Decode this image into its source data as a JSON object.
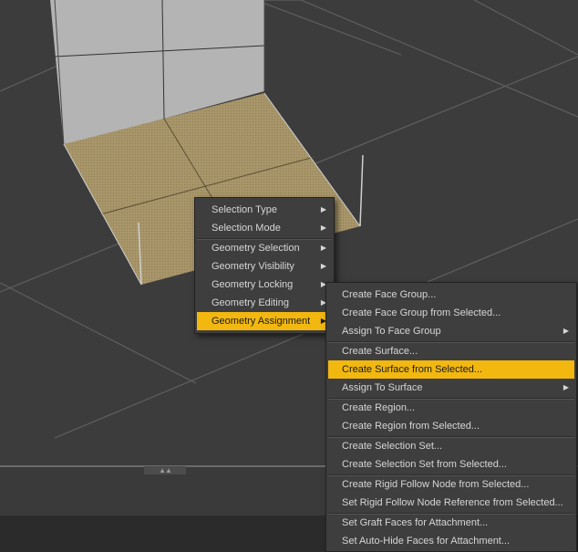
{
  "context_menu": {
    "groups": [
      [
        {
          "label": "Selection Type",
          "has_submenu": true
        },
        {
          "label": "Selection Mode",
          "has_submenu": true
        }
      ],
      [
        {
          "label": "Geometry Selection",
          "has_submenu": true
        },
        {
          "label": "Geometry Visibility",
          "has_submenu": true
        },
        {
          "label": "Geometry Locking",
          "has_submenu": true
        },
        {
          "label": "Geometry Editing",
          "has_submenu": true
        },
        {
          "label": "Geometry Assignment",
          "has_submenu": true,
          "highlighted": true
        }
      ]
    ]
  },
  "submenu": {
    "groups": [
      [
        {
          "label": "Create Face Group..."
        },
        {
          "label": "Create Face Group from Selected..."
        },
        {
          "label": "Assign To Face Group",
          "has_submenu": true
        }
      ],
      [
        {
          "label": "Create Surface..."
        },
        {
          "label": "Create Surface from Selected...",
          "highlighted": true
        },
        {
          "label": "Assign To Surface",
          "has_submenu": true
        }
      ],
      [
        {
          "label": "Create Region..."
        },
        {
          "label": "Create Region from Selected..."
        }
      ],
      [
        {
          "label": "Create Selection Set..."
        },
        {
          "label": "Create Selection Set from Selected..."
        }
      ],
      [
        {
          "label": "Create Rigid Follow Node from Selected..."
        },
        {
          "label": "Set Rigid Follow Node Reference from Selected..."
        }
      ],
      [
        {
          "label": "Set Graft Faces for Attachment..."
        },
        {
          "label": "Set Auto-Hide Faces for Attachment..."
        }
      ]
    ]
  },
  "colors": {
    "viewport_bg": "#3c3c3c",
    "menu_bg": "#3e3e3e",
    "highlight": "#f2b80f",
    "selected_faces": "#a8966a",
    "model_faces": "#b4b4b4"
  },
  "icons": {
    "submenu_arrow": "triangle-right-icon",
    "panel_grip": "double-chevron-icon"
  }
}
